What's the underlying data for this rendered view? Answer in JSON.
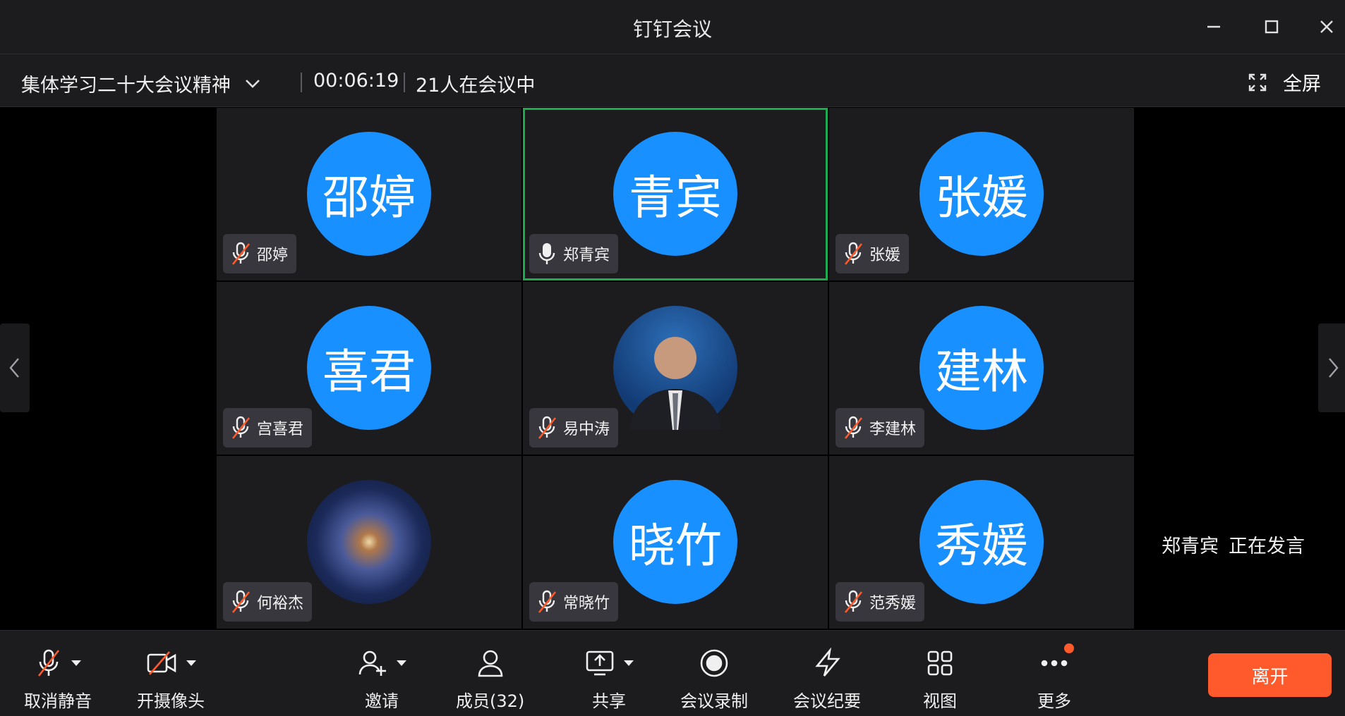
{
  "window": {
    "title": "钉钉会议",
    "minimize_icon": "minimize-icon",
    "maximize_icon": "maximize-icon",
    "close_icon": "close-icon"
  },
  "infobar": {
    "meeting_name": "集体学习二十大会议精神",
    "timer": "00:06:19",
    "participants_in_meeting": "21人在会议中",
    "fullscreen_label": "全屏"
  },
  "tiles": [
    {
      "avatar_text": "邵婷",
      "name": "邵婷",
      "mic": "muted",
      "avatar_type": "initials"
    },
    {
      "avatar_text": "青宾",
      "name": "郑青宾",
      "mic": "on",
      "avatar_type": "initials",
      "active_speaker": true
    },
    {
      "avatar_text": "张媛",
      "name": "张媛",
      "mic": "muted",
      "avatar_type": "initials"
    },
    {
      "avatar_text": "喜君",
      "name": "宫喜君",
      "mic": "muted",
      "avatar_type": "initials"
    },
    {
      "avatar_text": "",
      "name": "易中涛",
      "mic": "muted",
      "avatar_type": "photo"
    },
    {
      "avatar_text": "建林",
      "name": "李建林",
      "mic": "muted",
      "avatar_type": "initials"
    },
    {
      "avatar_text": "",
      "name": "何裕杰",
      "mic": "muted",
      "avatar_type": "galaxy-image"
    },
    {
      "avatar_text": "晓竹",
      "name": "常晓竹",
      "mic": "muted",
      "avatar_type": "initials"
    },
    {
      "avatar_text": "秀媛",
      "name": "范秀媛",
      "mic": "muted",
      "avatar_type": "initials"
    }
  ],
  "speaking": {
    "name": "郑青宾",
    "status": "正在发言"
  },
  "toolbar": {
    "unmute": "取消静音",
    "camera": "开摄像头",
    "invite": "邀请",
    "members": "成员(32)",
    "share": "共享",
    "record": "会议录制",
    "minutes": "会议纪要",
    "view": "视图",
    "more": "更多",
    "leave": "离开"
  },
  "colors": {
    "avatar_blue": "#1890ff",
    "active_border": "#1dac4b",
    "leave_button": "#ff5a2c",
    "muted_slash": "#ff5a2c"
  }
}
